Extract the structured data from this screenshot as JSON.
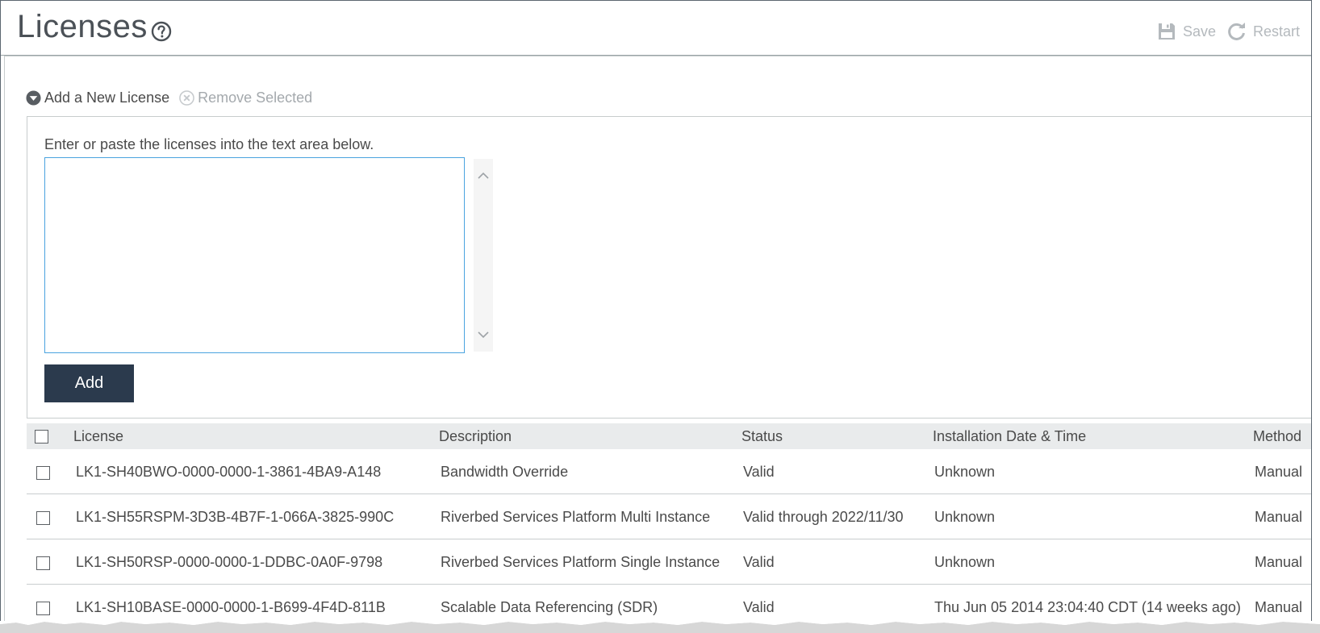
{
  "header": {
    "title": "Licenses",
    "save_label": "Save",
    "restart_label": "Restart"
  },
  "actions": {
    "add_label": "Add a New License",
    "remove_label": "Remove Selected"
  },
  "add_panel": {
    "instructions": "Enter or paste the licenses into the text area below.",
    "textarea_value": "",
    "add_button_label": "Add"
  },
  "table": {
    "columns": [
      "License",
      "Description",
      "Status",
      "Installation Date & Time",
      "Method"
    ],
    "rows": [
      {
        "license": "LK1-SH40BWO-0000-0000-1-3861-4BA9-A148",
        "description": "Bandwidth Override",
        "status": "Valid",
        "date": "Unknown",
        "method": "Manual"
      },
      {
        "license": "LK1-SH55RSPM-3D3B-4B7F-1-066A-3825-990C",
        "description": "Riverbed Services Platform Multi Instance",
        "status": "Valid through 2022/11/30",
        "date": "Unknown",
        "method": "Manual"
      },
      {
        "license": "LK1-SH50RSP-0000-0000-1-DDBC-0A0F-9798",
        "description": "Riverbed Services Platform Single Instance",
        "status": "Valid",
        "date": "Unknown",
        "method": "Manual"
      },
      {
        "license": "LK1-SH10BASE-0000-0000-1-B699-4F4D-811B",
        "description": "Scalable Data Referencing (SDR)",
        "status": "Valid",
        "date": "Thu Jun 05 2014 23:04:40 CDT (14 weeks ago)",
        "method": "Manual"
      }
    ]
  },
  "colors": {
    "primary_button": "#2b3a4d",
    "textarea_focus": "#4aa3df",
    "disabled_text": "#b4b9bd",
    "header_row": "#e9ebec"
  },
  "icons": {
    "help": "help-circle-icon",
    "save": "floppy-disk-icon",
    "restart": "refresh-icon",
    "add": "triangle-down-circle-icon",
    "remove": "x-circle-icon"
  }
}
